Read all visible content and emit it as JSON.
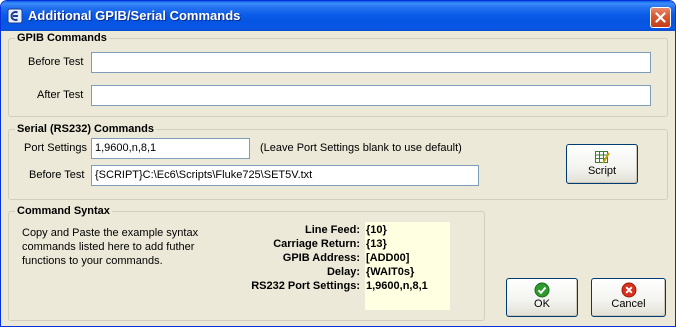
{
  "window": {
    "title": "Additional GPIB/Serial Commands"
  },
  "gpib": {
    "legend": "GPIB Commands",
    "before_label": "Before Test",
    "before_value": "",
    "after_label": "After Test",
    "after_value": ""
  },
  "serial": {
    "legend": "Serial (RS232) Commands",
    "port_label": "Port Settings",
    "port_value": "1,9600,n,8,1",
    "port_hint": "(Leave Port Settings blank to use default)",
    "before_label": "Before Test",
    "before_value": "{SCRIPT}C:\\Ec6\\Scripts\\Fluke725\\SET5V.txt",
    "script_button": "Script"
  },
  "syntax": {
    "legend": "Command Syntax",
    "description": [
      "Copy and Paste the example syntax",
      "commands listed here to add futher",
      "functions to your commands."
    ],
    "rows": [
      {
        "label": "Line Feed:",
        "value": "{10}"
      },
      {
        "label": "Carriage Return:",
        "value": "{13}"
      },
      {
        "label": "GPIB Address:",
        "value": "[ADD00]"
      },
      {
        "label": "Delay:",
        "value": "{WAIT0s}"
      },
      {
        "label": "RS232 Port Settings:",
        "value": "1,9600,n,8,1"
      }
    ]
  },
  "buttons": {
    "ok": "OK",
    "cancel": "Cancel"
  },
  "icons": {
    "title": "app-icon",
    "close": "close-icon",
    "script": "script-grid-icon",
    "ok": "green-check-icon",
    "cancel": "red-x-icon"
  }
}
